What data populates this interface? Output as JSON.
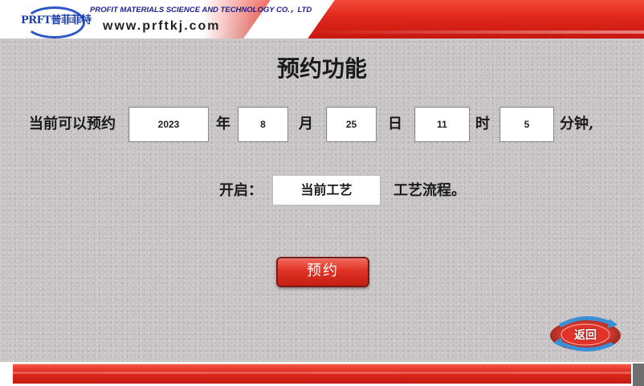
{
  "header": {
    "logo_text": "PRFT普菲菲特",
    "company_name": "PROFIT MATERIALS SCIENCE AND TECHNOLOGY CO.，LTD",
    "website": "www.prftkj.com"
  },
  "page": {
    "title": "预约功能",
    "schedule_prefix": "当前可以预约",
    "year_unit": "年",
    "month_unit": "月",
    "day_unit": "日",
    "hour_unit": "时",
    "minute_unit": "分钟,",
    "open_label": "开启：",
    "process_suffix": "工艺流程。"
  },
  "fields": {
    "year": "2023",
    "month": "8",
    "day": "25",
    "hour": "11",
    "minute": "5",
    "process": "当前工艺"
  },
  "buttons": {
    "reserve_label": "预约",
    "back_label": "返回"
  },
  "colors": {
    "accent_red": "#e0261a",
    "panel_gray": "#c8c4c6",
    "back_button_blue": "#3a8fd6"
  }
}
